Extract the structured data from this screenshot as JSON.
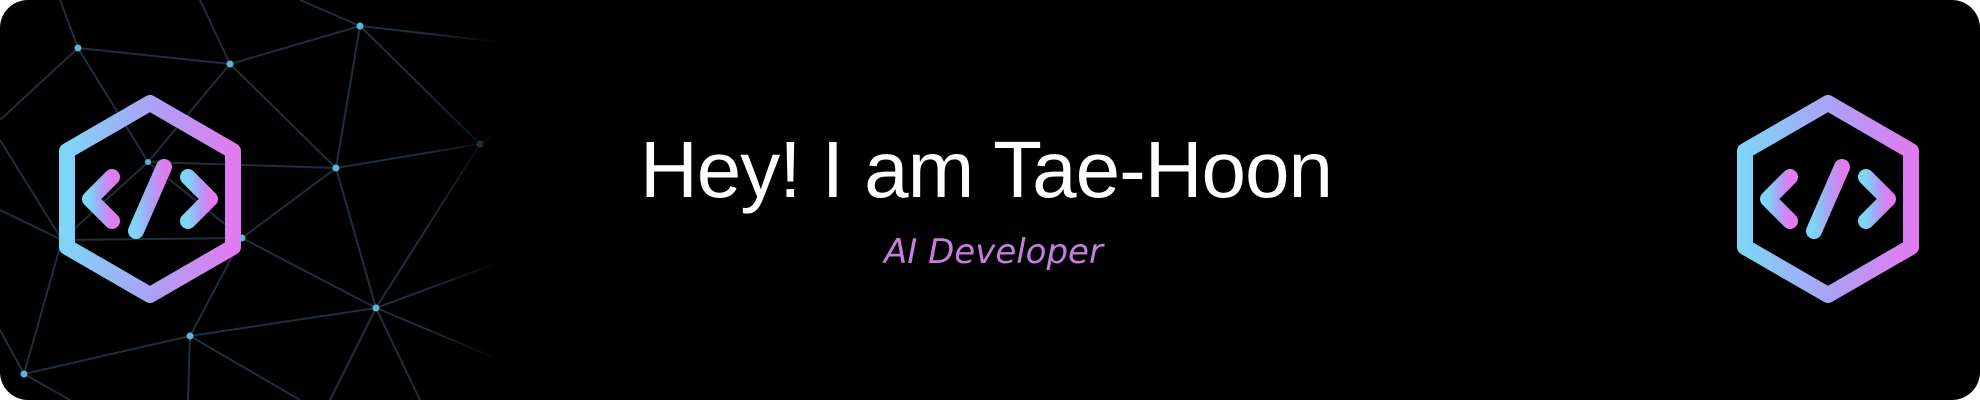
{
  "banner": {
    "headline": "Hey! I am Tae-Hoon",
    "subtitle": "AI Developer"
  },
  "colors": {
    "background": "#000000",
    "headline": "#ffffff",
    "subtitle": "#c77dde",
    "gradient_start": "#7fd4f7",
    "gradient_mid": "#a9a3f5",
    "gradient_end": "#e07cf0",
    "network_line": "#1f2e3a",
    "network_node": "#5fb4d6"
  },
  "icons": {
    "left_logo": "code-brackets-hexagon-icon",
    "right_logo": "code-brackets-hexagon-icon",
    "background_pattern": "network-graph"
  }
}
